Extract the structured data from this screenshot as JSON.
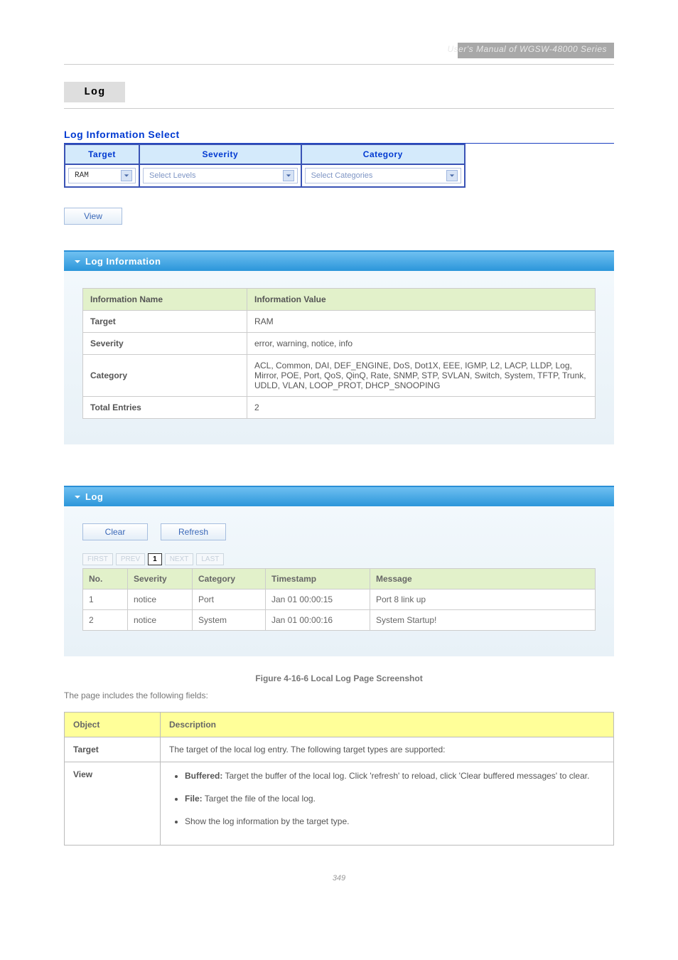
{
  "top_bar_text": "User's Manual of WGSW-48000 Series",
  "tab_label": "Log",
  "section_title": "Log Information Select",
  "sel_headers": [
    "Target",
    "Severity",
    "Category"
  ],
  "target_value": "RAM",
  "severity_placeholder": "Select Levels",
  "category_placeholder": "Select Categories",
  "view_btn": "View",
  "panel1_title": "Log Information",
  "info_headers": {
    "name": "Information Name",
    "value": "Information Value"
  },
  "info_rows": [
    {
      "name": "Target",
      "value": "RAM"
    },
    {
      "name": "Severity",
      "value": "error, warning, notice, info"
    },
    {
      "name": "Category",
      "value": "ACL, Common, DAI, DEF_ENGINE, DoS, Dot1X, EEE, IGMP, L2, LACP, LLDP, Log, Mirror, POE, Port, QoS, QinQ, Rate, SNMP, STP, SVLAN, Switch, System, TFTP, Trunk, UDLD, VLAN, LOOP_PROT, DHCP_SNOOPING"
    }
  ],
  "totals": {
    "label": "Total Entries",
    "value": "2"
  },
  "panel2_title": "Log",
  "clear_btn": "Clear",
  "refresh_btn": "Refresh",
  "pager": {
    "first": "FIRST",
    "prev": "PREV",
    "current": "1",
    "next": "NEXT",
    "last": "LAST"
  },
  "log_headers": [
    "No.",
    "Severity",
    "Category",
    "Timestamp",
    "Message"
  ],
  "log_rows": [
    {
      "no": "1",
      "severity": "notice",
      "category": "Port",
      "timestamp": "Jan 01 00:00:15",
      "message": "Port 8 link up"
    },
    {
      "no": "2",
      "severity": "notice",
      "category": "System",
      "timestamp": "Jan 01 00:00:16",
      "message": "System Startup!"
    }
  ],
  "figure_caption": "Figure 4-16-6 Local Log Page Screenshot",
  "page_desc": "The page includes the following fields:",
  "obj_headers": {
    "obj": "Object",
    "desc": "Description"
  },
  "obj_rows": {
    "target": {
      "name": "Target",
      "desc": "The target of the local log entry. The following target types are supported:"
    },
    "view_row": {
      "name": "View",
      "bullets": [
        {
          "label": "Buffered:",
          "text": " Target the buffer of the local log. Click 'refresh' to reload, click 'Clear buffered messages' to clear."
        },
        {
          "label": "File:",
          "text": " Target the file of the local log."
        },
        {
          "label": "Show the log information by the target type."
        }
      ]
    }
  },
  "page_number": "349"
}
